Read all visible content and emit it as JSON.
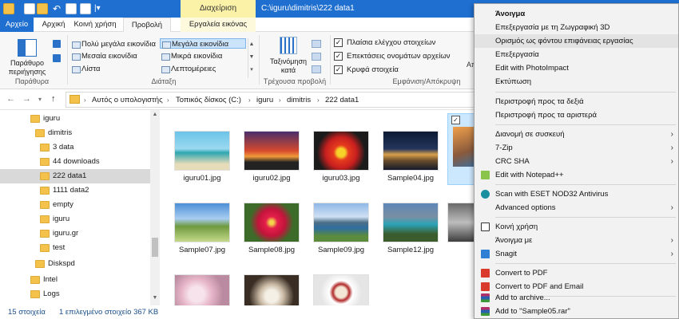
{
  "titlebar": {
    "manage_tab": "Διαχείριση",
    "path_title": "C:\\iguru\\dimitris\\222 data1"
  },
  "tabs": {
    "file": "Αρχείο",
    "home": "Αρχική",
    "share": "Κοινή χρήση",
    "view": "Προβολή",
    "image_tools": "Εργαλεία εικόνας"
  },
  "ribbon": {
    "nav_pane_label": "Παράθυρο περιήγησης",
    "panes_group": "Παράθυρα",
    "layout_group": "Διάταξη",
    "current_view_group": "Τρέχουσα προβολή",
    "show_hide_group": "Εμφάνιση/Απόκρυψη",
    "layout": {
      "extra_large": "Πολύ μεγάλα εικονίδια",
      "large": "Μεγάλα εικονίδια",
      "medium": "Μεσαία εικονίδια",
      "small": "Μικρά εικονίδια",
      "list": "Λίστα",
      "details": "Λεπτομέρειες"
    },
    "sort_label": "Ταξινόμηση κατά",
    "checks": {
      "item_checkboxes": "Πλαίσια ελέγχου στοιχείων",
      "file_extensions": "Επεκτάσεις ονομάτων αρχείων",
      "hidden_items": "Κρυφά στοιχεία"
    },
    "hide_selected_partial": "Απ"
  },
  "address": {
    "crumbs": [
      "Αυτός ο υπολογιστής",
      "Τοπικός δίσκος (C:)",
      "iguru",
      "dimitris",
      "222 data1"
    ]
  },
  "tree": {
    "items": [
      {
        "label": "iguru"
      },
      {
        "label": "dimitris"
      },
      {
        "label": "3 data"
      },
      {
        "label": "44 downloads"
      },
      {
        "label": "222 data1"
      },
      {
        "label": "1111 data2"
      },
      {
        "label": "empty"
      },
      {
        "label": "iguru"
      },
      {
        "label": "iguru.gr"
      },
      {
        "label": "test"
      },
      {
        "label": "Diskspd"
      },
      {
        "label": "Intel"
      },
      {
        "label": "Logs"
      }
    ]
  },
  "files": [
    {
      "name": "iguru01.jpg"
    },
    {
      "name": "iguru02.jpg"
    },
    {
      "name": "iguru03.jpg"
    },
    {
      "name": "Sample04.jpg"
    },
    {
      "name": "Sample07.jpg"
    },
    {
      "name": "Sample08.jpg"
    },
    {
      "name": "Sample09.jpg"
    },
    {
      "name": "Sample12.jpg"
    }
  ],
  "status": {
    "count": "15 στοιχεία",
    "selected": "1 επιλεγμένο στοιχείο  367 KB"
  },
  "menu": {
    "items": [
      {
        "label": "Άνοιγμα"
      },
      {
        "label": "Επεξεργασία με τη Ζωγραφική 3D"
      },
      {
        "label": "Ορισμός ως φόντου επιφάνειας εργασίας"
      },
      {
        "label": "Επεξεργασία"
      },
      {
        "label": "Edit with PhotoImpact"
      },
      {
        "label": "Εκτύπωση"
      },
      {
        "label": "Περιστροφή προς τα δεξιά"
      },
      {
        "label": "Περιστροφή προς τα αριστερά"
      },
      {
        "label": "Διανομή σε συσκευή"
      },
      {
        "label": "7-Zip"
      },
      {
        "label": "CRC SHA"
      },
      {
        "label": "Edit with Notepad++"
      },
      {
        "label": "Scan with ESET NOD32 Antivirus"
      },
      {
        "label": "Advanced options"
      },
      {
        "label": "Κοινή χρήση"
      },
      {
        "label": "Άνοιγμα με"
      },
      {
        "label": "Snagit"
      },
      {
        "label": "Convert to PDF"
      },
      {
        "label": "Convert to PDF and Email"
      },
      {
        "label": "Add to archive..."
      },
      {
        "label": "Add to \"Sample05.rar\""
      }
    ]
  }
}
